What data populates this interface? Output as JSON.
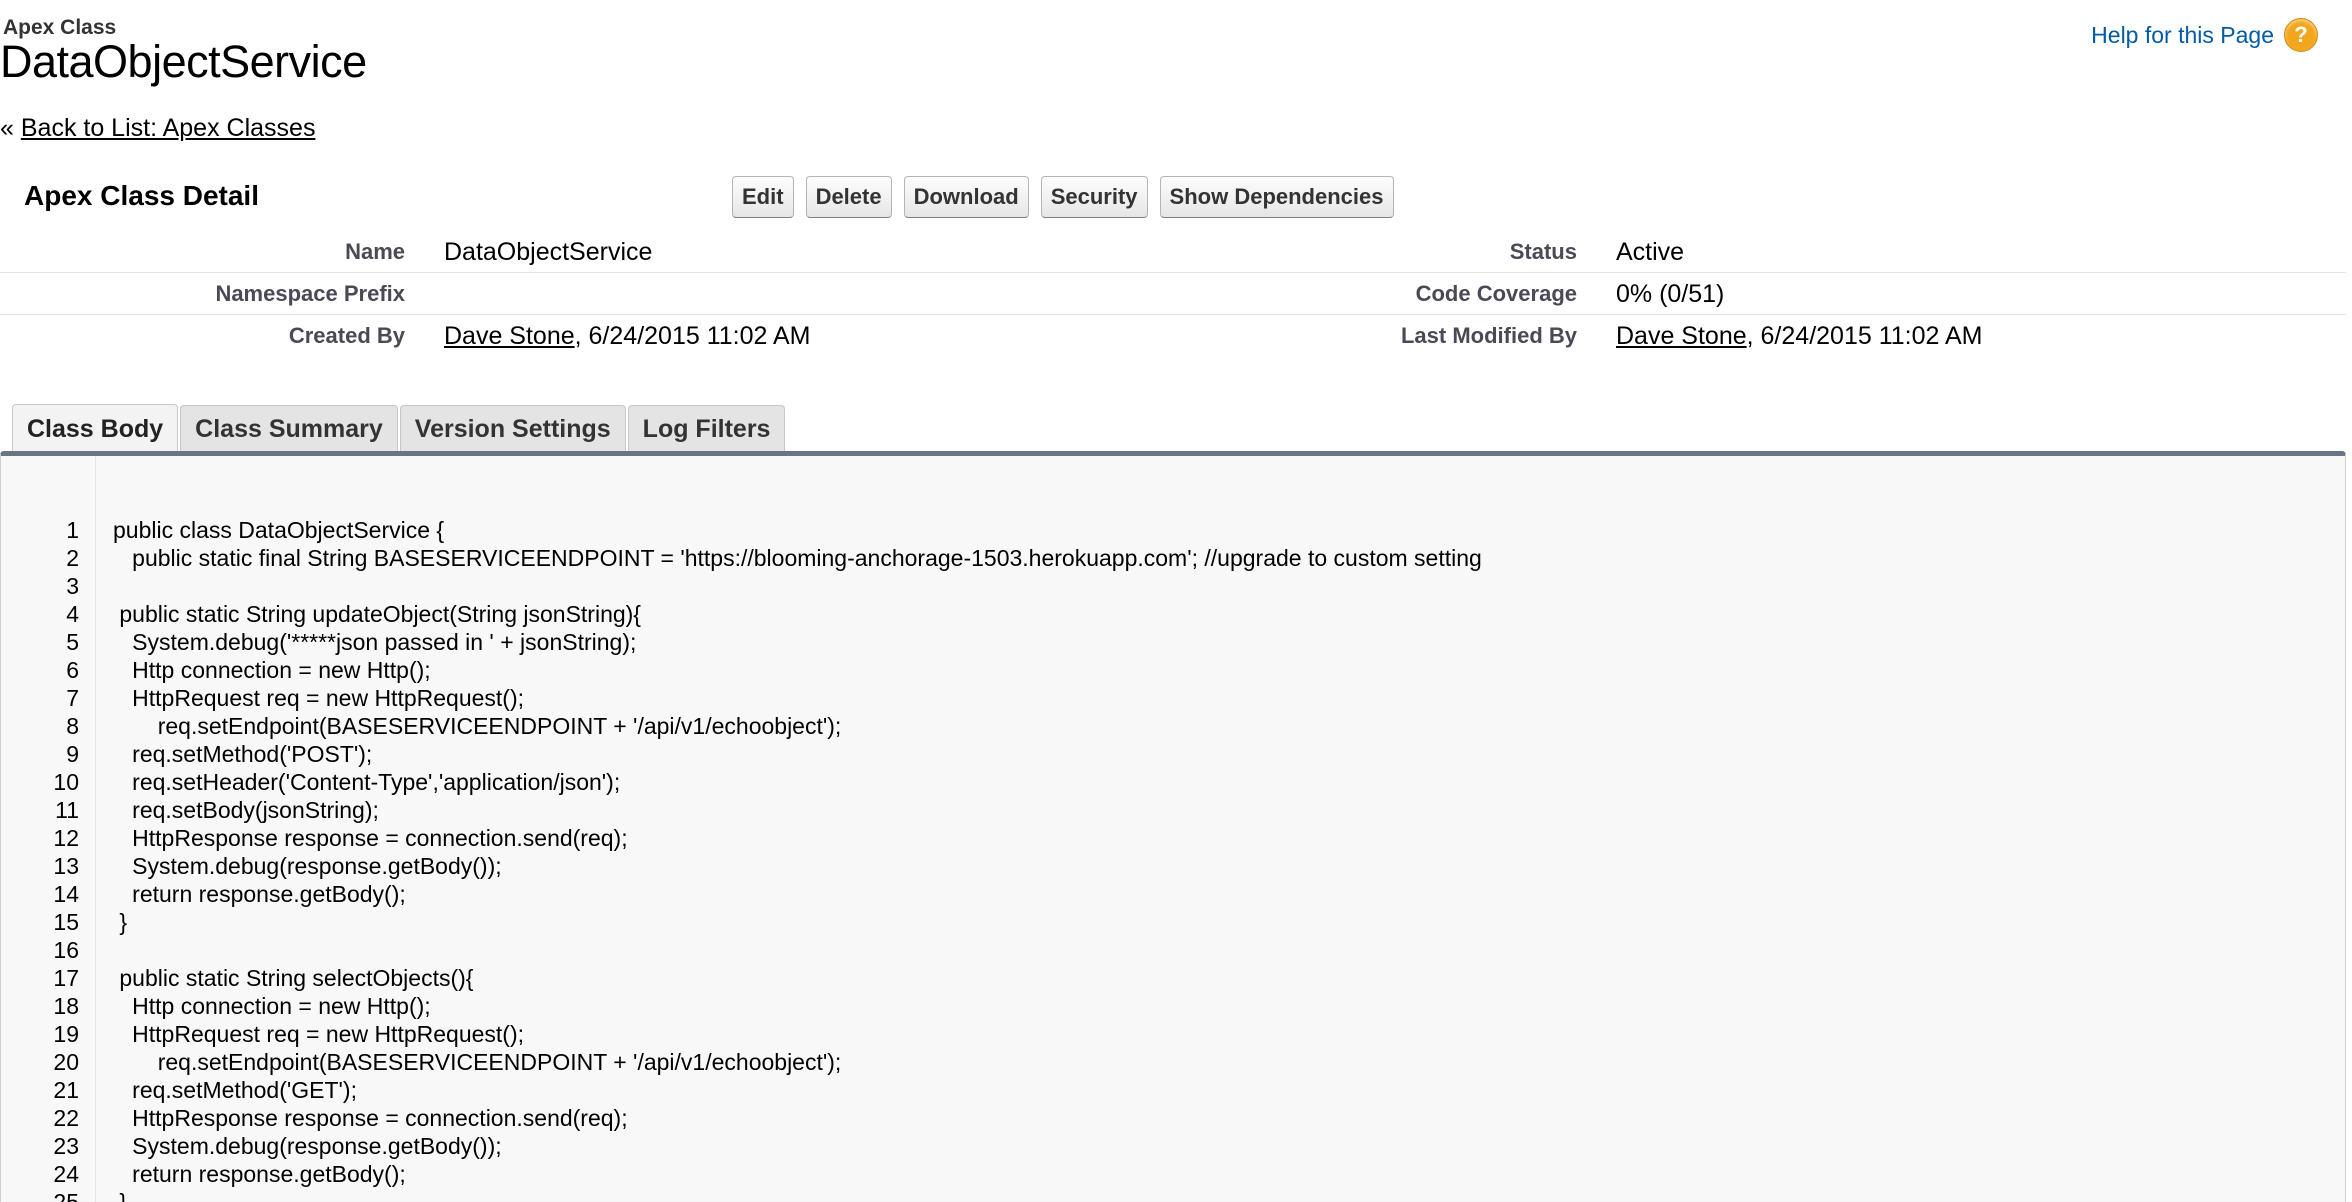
{
  "header": {
    "type_label": "Apex Class",
    "title": "DataObjectService",
    "help_link": "Help for this Page",
    "help_icon": "help-question-icon",
    "back_prefix": "« ",
    "back_link": "Back to List: Apex Classes"
  },
  "detail": {
    "title": "Apex Class Detail",
    "buttons": [
      "Edit",
      "Delete",
      "Download",
      "Security",
      "Show Dependencies"
    ],
    "fields": {
      "name_label": "Name",
      "name_value": "DataObjectService",
      "status_label": "Status",
      "status_value": "Active",
      "namespace_label": "Namespace Prefix",
      "namespace_value": "",
      "coverage_label": "Code Coverage",
      "coverage_value": "0% (0/51)",
      "created_label": "Created By",
      "created_user": "Dave Stone",
      "created_date": ", 6/24/2015 11:02 AM",
      "modified_label": "Last Modified By",
      "modified_user": "Dave Stone",
      "modified_date": ", 6/24/2015 11:02 AM"
    }
  },
  "tabs": [
    "Class Body",
    "Class Summary",
    "Version Settings",
    "Log Filters"
  ],
  "code": {
    "lines": [
      "public class DataObjectService {",
      "   public static final String BASESERVICEENDPOINT = 'https://blooming-anchorage-1503.herokuapp.com'; //upgrade to custom setting",
      "",
      " public static String updateObject(String jsonString){",
      "   System.debug('*****json passed in ' + jsonString);",
      "   Http connection = new Http();",
      "   HttpRequest req = new HttpRequest();",
      "       req.setEndpoint(BASESERVICEENDPOINT + '/api/v1/echoobject');",
      "   req.setMethod('POST');",
      "   req.setHeader('Content-Type','application/json');",
      "   req.setBody(jsonString);",
      "   HttpResponse response = connection.send(req);",
      "   System.debug(response.getBody());",
      "   return response.getBody();",
      " }",
      "",
      " public static String selectObjects(){",
      "   Http connection = new Http();",
      "   HttpRequest req = new HttpRequest();",
      "       req.setEndpoint(BASESERVICEENDPOINT + '/api/v1/echoobject');",
      "   req.setMethod('GET');",
      "   HttpResponse response = connection.send(req);",
      "   System.debug(response.getBody());",
      "   return response.getBody();",
      " }"
    ]
  }
}
